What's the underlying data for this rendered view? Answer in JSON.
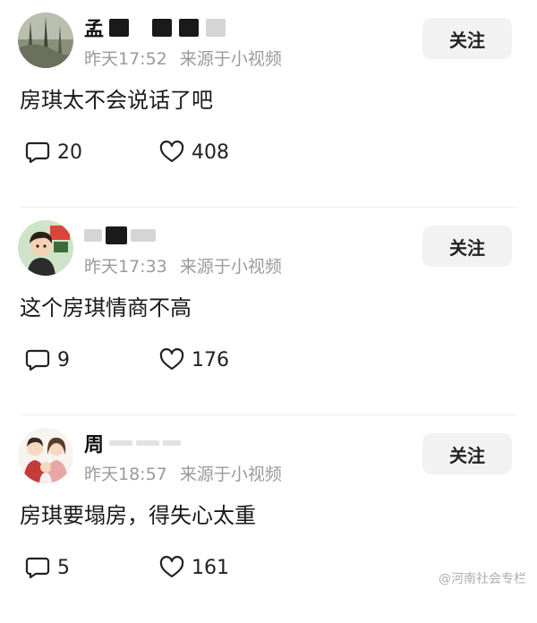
{
  "posts": [
    {
      "name_visible": "孟",
      "time": "昨天17:52",
      "source": "来源于小视频",
      "follow_label": "关注",
      "content": "房琪太不会说话了吧",
      "comments": "20",
      "likes": "408",
      "avatar_icon": "forest-avatar-icon"
    },
    {
      "name_visible": "",
      "time": "昨天17:33",
      "source": "来源于小视频",
      "follow_label": "关注",
      "content": "这个房琪情商不高",
      "comments": "9",
      "likes": "176",
      "avatar_icon": "cartoon-boy-avatar-icon"
    },
    {
      "name_visible": "周",
      "time": "昨天18:57",
      "source": "来源于小视频",
      "follow_label": "关注",
      "content": "房琪要塌房，得失心太重",
      "comments": "5",
      "likes": "161",
      "avatar_icon": "family-cartoon-avatar-icon"
    }
  ],
  "watermark": "@河南社会专栏",
  "colors": {
    "meta_text": "#9a9a9a",
    "button_bg": "#f2f2f2",
    "divider": "#efefef"
  }
}
